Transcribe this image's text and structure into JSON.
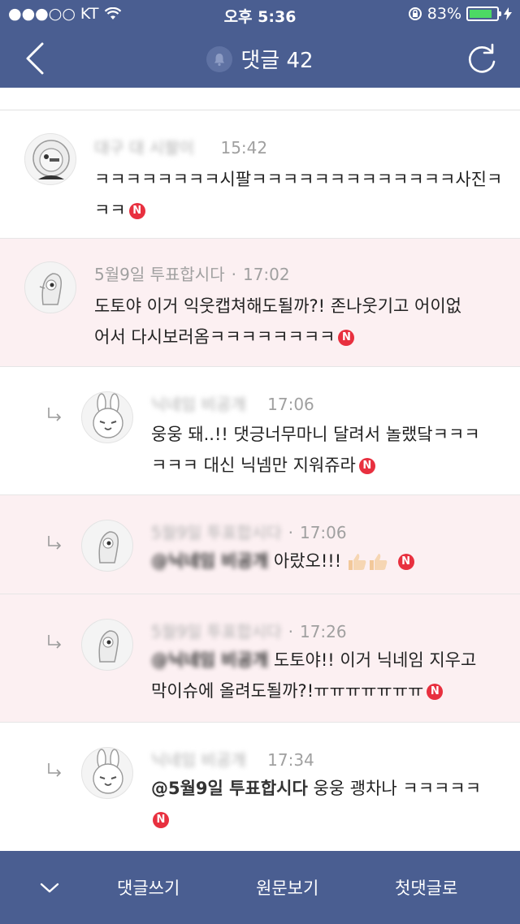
{
  "status": {
    "carrier": "●●●○○ KT",
    "time": "오후 5:36",
    "battery": "83%",
    "battery_level": 0.83
  },
  "nav": {
    "title": "댓글 42"
  },
  "comments": [
    {
      "nick": "대구 대 시팔이",
      "time": "15:42",
      "text1": "ㅋㅋㅋㅋㅋㅋㅋㅋ시팔ㅋㅋㅋㅋㅋㅋㅋㅋㅋㅋㅋㅋㅋ사진ㅋ",
      "text2": "ㅋㅋ"
    },
    {
      "nick": "5월9일 투표합시다",
      "time": "17:02",
      "text1": "도토야 이거 익웃캡쳐해도될까?! 존나웃기고 어이없",
      "text2": "어서 다시보러옴ㅋㅋㅋㅋㅋㅋㅋㅋ"
    },
    {
      "nick": "닉네임 비공개",
      "time": "17:06",
      "text1": "웅웅 돼..!! 댓긍너무마니 달려서 놀랬닼ㅋㅋㅋ",
      "text2": "ㅋㅋㅋ 대신 닉넴만 지워쥬라"
    },
    {
      "nick": "5월9일 투표합시다",
      "time": "17:06",
      "mention": "@닉네임 비공개",
      "text1": "아랐오!!!"
    },
    {
      "nick": "5월9일 투표합시다",
      "time": "17:26",
      "mention": "@닉네임 비공개",
      "text1": "도토야!! 이거 닉네임 지우고",
      "text2": "막이슈에 올려도될까?!ㅠㅠㅠㅠㅠㅠㅠ"
    },
    {
      "nick": "닉네임 비공개",
      "time": "17:34",
      "mention": "@5월9일 투표합시다",
      "text1": "웅웅 괭차나 ㅋㅋㅋㅋㅋ"
    }
  ],
  "badge": "N",
  "bottom": {
    "write": "댓글쓰기",
    "original": "원문보기",
    "first": "첫댓글로"
  },
  "colors": {
    "bar": "#4a5e91",
    "highlight": "#fcf0f2",
    "badge": "#e8303f"
  }
}
